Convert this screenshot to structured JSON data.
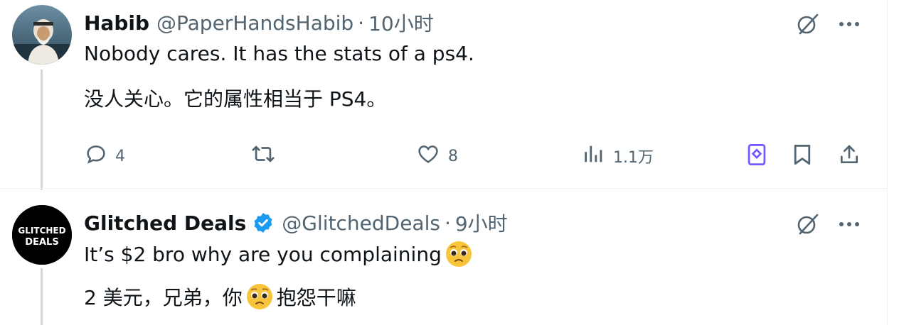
{
  "tweets": [
    {
      "name": "Habib",
      "handle": "@PaperHandsHabib",
      "separator": "·",
      "time": "10小时",
      "text": "Nobody cares. It has the stats of a ps4.",
      "translation": "没人关心。它的属性相当于 PS4。",
      "actions": {
        "replies": "4",
        "retweets": "",
        "likes": "8",
        "views": "1.1万"
      },
      "verified": false
    },
    {
      "name": "Glitched Deals",
      "handle": "@GlitchedDeals",
      "separator": "·",
      "time": "9小时",
      "text_before_emoji": "It’s $2 bro why are you complaining",
      "translation_before_emoji": "2 美元，兄弟，你",
      "translation_after_emoji": "抱怨干嘛",
      "emoji": "pleading-face-emoji",
      "avatar_text_line1": "GLITCHED",
      "avatar_text_line2": "DEALS",
      "verified": true
    }
  ],
  "icons": {
    "grok": "grok-icon",
    "more": "more-icon",
    "reply": "reply-icon",
    "retweet": "retweet-icon",
    "like": "heart-icon",
    "views": "views-icon",
    "bookmark_purple": "premium-bookmark-icon",
    "bookmark": "bookmark-icon",
    "share": "share-icon"
  },
  "colors": {
    "text": "#0f1419",
    "secondary": "#536471",
    "verified_blue": "#1d9bf0",
    "purple_accent": "#7856ff",
    "thread_line": "#cfd9de"
  }
}
